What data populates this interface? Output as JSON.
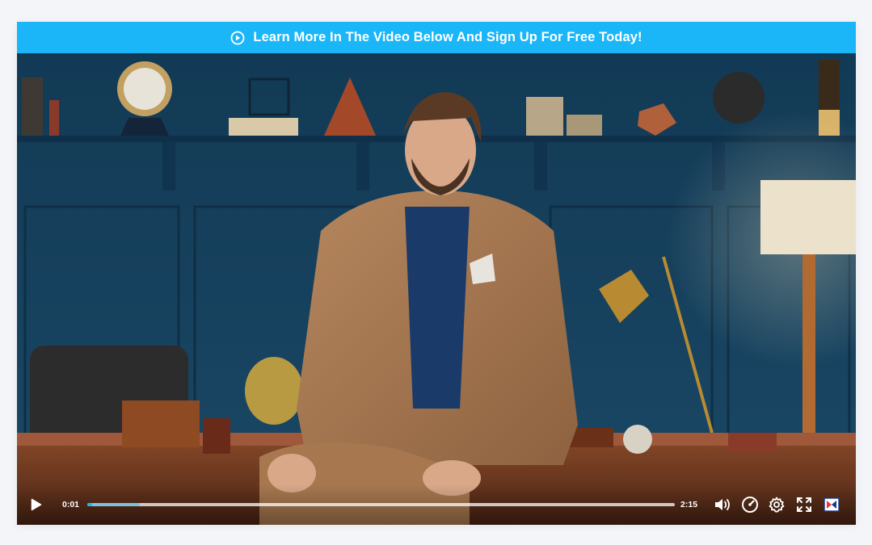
{
  "banner": {
    "text": "Learn More In The Video Below And Sign Up For Free Today!",
    "icon": "play-circle-icon",
    "background": "#1ab6f7"
  },
  "player": {
    "current_time": "0:01",
    "duration": "2:15",
    "progress_played_fraction": 0.008,
    "progress_buffered_fraction": 0.09,
    "accent": "#1ab6f7",
    "controls": {
      "play_icon": "play-icon",
      "volume_icon": "volume-icon",
      "speed_icon": "playback-speed-icon",
      "settings_icon": "gear-icon",
      "fullscreen_icon": "fullscreen-icon",
      "brand_icon": "player-brand-icon"
    }
  }
}
